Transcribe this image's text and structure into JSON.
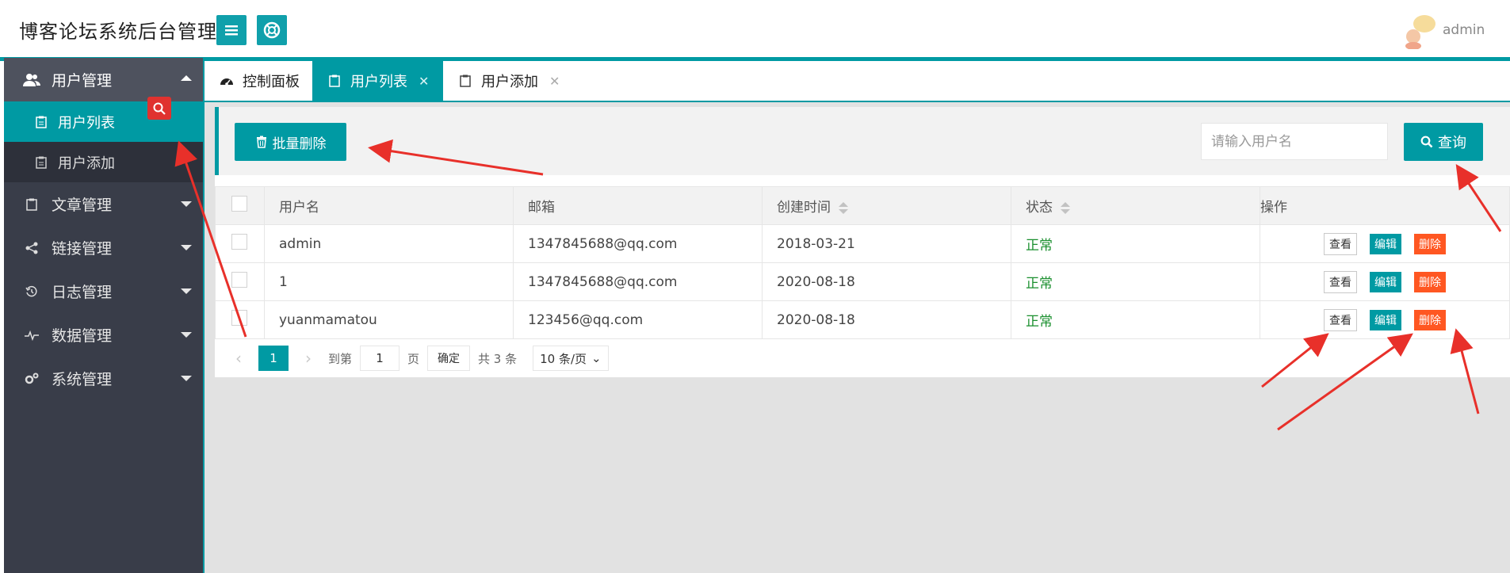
{
  "app": {
    "title": "博客论坛系统后台管理",
    "user": "admin",
    "accent_color": "#009aa3"
  },
  "sidebar": {
    "menus": [
      {
        "label": "用户管理",
        "icon": "users-icon",
        "expanded": true,
        "items": [
          {
            "label": "用户列表",
            "icon": "clipboard-icon",
            "selected": true
          },
          {
            "label": "用户添加",
            "icon": "clipboard-icon",
            "selected": false
          }
        ]
      },
      {
        "label": "文章管理",
        "icon": "clipboard-icon"
      },
      {
        "label": "链接管理",
        "icon": "share-icon"
      },
      {
        "label": "日志管理",
        "icon": "history-icon"
      },
      {
        "label": "数据管理",
        "icon": "pulse-icon"
      },
      {
        "label": "系统管理",
        "icon": "gears-icon"
      }
    ]
  },
  "tabs": [
    {
      "label": "控制面板",
      "icon": "dashboard-icon",
      "closable": false,
      "active": false
    },
    {
      "label": "用户列表",
      "icon": "clipboard-icon",
      "closable": true,
      "active": true
    },
    {
      "label": "用户添加",
      "icon": "clipboard-icon",
      "closable": true,
      "active": false
    }
  ],
  "toolbar": {
    "bulk_delete_label": "批量删除",
    "search_placeholder": "请输入用户名",
    "query_label": "查询"
  },
  "table": {
    "columns": [
      "用户名",
      "邮箱",
      "创建时间",
      "状态",
      "操作"
    ],
    "sortable": [
      "创建时间",
      "状态"
    ],
    "rows": [
      {
        "username": "admin",
        "email": "1347845688@qq.com",
        "created": "2018-03-21",
        "status": "正常"
      },
      {
        "username": "1",
        "email": "1347845688@qq.com",
        "created": "2020-08-18",
        "status": "正常"
      },
      {
        "username": "yuanmamatou",
        "email": "123456@qq.com",
        "created": "2020-08-18",
        "status": "正常"
      }
    ],
    "actions": {
      "view": "查看",
      "edit": "编辑",
      "delete": "删除"
    }
  },
  "pager": {
    "current_page": "1",
    "goto_prefix": "到第",
    "goto_value": "1",
    "goto_suffix": "页",
    "confirm_label": "确定",
    "total_label": "共 3 条",
    "page_size_label": "10 条/页"
  }
}
